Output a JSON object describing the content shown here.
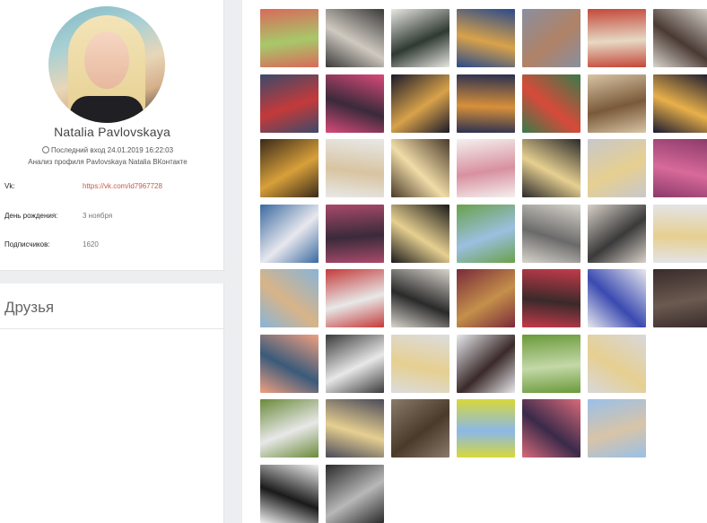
{
  "profile": {
    "name": "Natalia Pavlovskaya",
    "last_visit": "Последний вход 24.01.2019 16:22:03",
    "analysis": "Анализ профиля Pavlovskaya Natalia ВКонтакте",
    "fields": [
      {
        "label": "Vk:",
        "value": "https://vk.com/id7967728"
      },
      {
        "label": "День рождения:",
        "value": "3 ноября"
      },
      {
        "label": "Подписчиков:",
        "value": "1620"
      }
    ]
  },
  "friends": {
    "title": "Друзья"
  },
  "gallery": {
    "photos": [
      [
        "#d86a5a",
        "#a8c86a"
      ],
      [
        "#3a3a3a",
        "#cfc9c0"
      ],
      [
        "#e8e6e2",
        "#2f3a32"
      ],
      [
        "#2a4a8a",
        "#d9a24a"
      ],
      [
        "#8a8fa0",
        "#b08266"
      ],
      [
        "#c4483a",
        "#e6d9c4"
      ],
      [
        "#d8d4cc",
        "#4a3a34"
      ],
      [
        "#3c4a6a",
        "#c43a3a"
      ],
      [
        "#d84a7a",
        "#3a2a3a"
      ],
      [
        "#1a1a2a",
        "#d8a24a"
      ],
      [
        "#2a3050",
        "#d8903a"
      ],
      [
        "#3a7a4a",
        "#d84a3a"
      ],
      [
        "#d8c4a4",
        "#7a5a3a"
      ],
      [
        "#1a1a30",
        "#e8b04a"
      ],
      [
        "#3a2a1a",
        "#d8a03a"
      ],
      [
        "#e8e8e8",
        "#d8c4a0"
      ],
      [
        "#4a3a2a",
        "#f0dca8"
      ],
      [
        "#f4f0ee",
        "#d890a0"
      ],
      [
        "#2a2a2a",
        "#e6cf90"
      ],
      [
        "#c8c8cc",
        "#e6cf90"
      ],
      [
        "#8a3a6a",
        "#d86a9a"
      ],
      [
        "#3a6aa0",
        "#e8e8ee"
      ],
      [
        "#a84a6a",
        "#3a2a3a"
      ],
      [
        "#1a1a1a",
        "#e6cf90"
      ],
      [
        "#6aa04a",
        "#9ac0e0"
      ],
      [
        "#d8d4cc",
        "#6a6a6a"
      ],
      [
        "#d8d0c8",
        "#3a3a3a"
      ],
      [
        "#e4e4e8",
        "#e6cf90"
      ],
      [
        "#88b4d8",
        "#d8b488"
      ],
      [
        "#c43a3a",
        "#e8e8e8"
      ],
      [
        "#d8d4cc",
        "#2a2a2a"
      ],
      [
        "#7a2a3a",
        "#c4904a"
      ],
      [
        "#c43a4a",
        "#3a2a2a"
      ],
      [
        "#e8e8ee",
        "#3a4ab0"
      ],
      [
        "#3a2a2a",
        "#6a5a50"
      ],
      [
        "#f0a080",
        "#3a5a7a"
      ],
      [
        "#3a3a3a",
        "#e8e8e8"
      ],
      [
        "#dcdcdc",
        "#e6cf90"
      ],
      [
        "#e8e8ec",
        "#3a2a2a"
      ],
      [
        "#6a9a3a",
        "#c4d8a8"
      ],
      [
        "#d8d8dc",
        "#e6cf90"
      ],
      [
        "#6a8a3a",
        "#e8e8e8"
      ],
      [
        "#4a4a5a",
        "#e6cf90"
      ],
      [
        "#8a7a6a",
        "#4a3a2a"
      ],
      [
        "#d8d83a",
        "#8ab8e8"
      ],
      [
        "#d86a7a",
        "#3a2a4a"
      ],
      [
        "#9ac0e8",
        "#d8c4a8"
      ],
      [
        "#f0f0f0",
        "#1a1a1a"
      ],
      [
        "#2a2a2a",
        "#b8b8b8"
      ]
    ]
  }
}
